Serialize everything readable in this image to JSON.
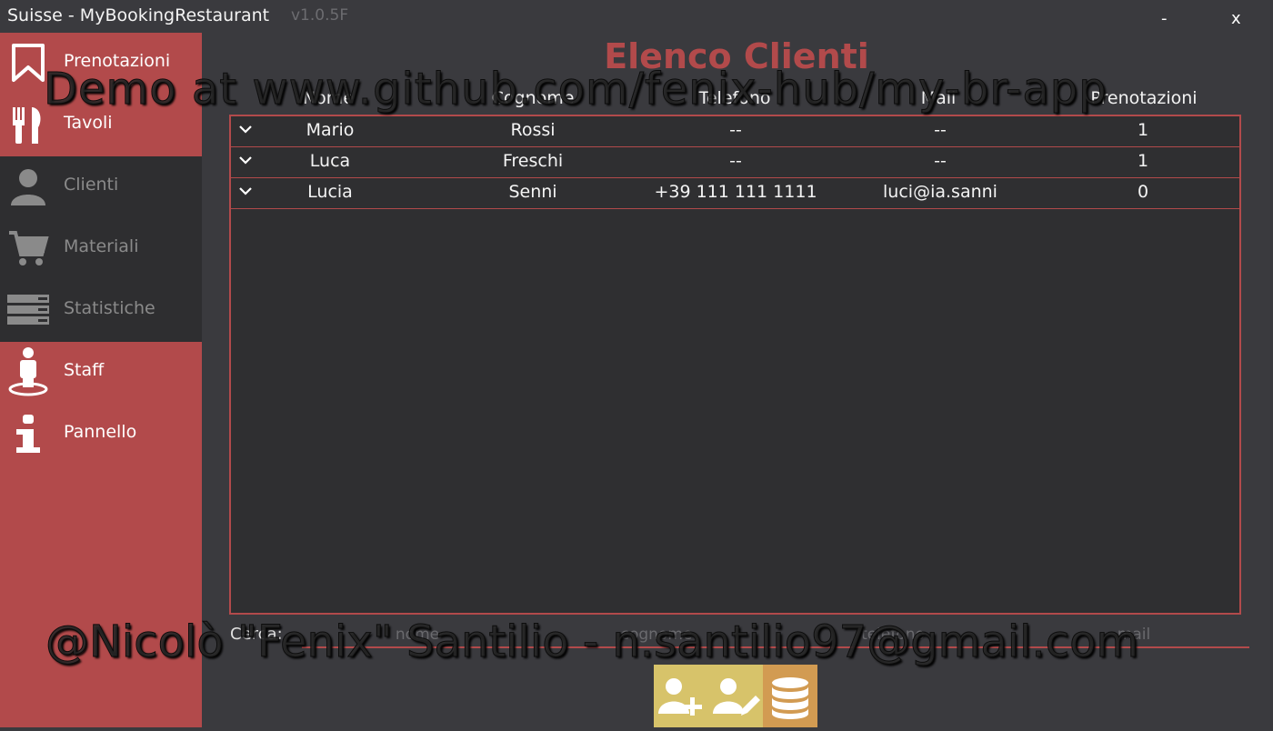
{
  "window": {
    "title": "Suisse - MyBookingRestaurant",
    "version": "v1.0.5F",
    "minimize": "-",
    "close": "x"
  },
  "sidebar": {
    "items": [
      {
        "label": "Prenotazioni",
        "icon": "bookmark-icon",
        "active": true
      },
      {
        "label": "Tavoli",
        "icon": "fork-knife-icon",
        "active": true
      },
      {
        "label": "Clienti",
        "icon": "user-icon",
        "active": false
      },
      {
        "label": "Materiali",
        "icon": "cart-icon",
        "active": false
      },
      {
        "label": "Statistiche",
        "icon": "server-icon",
        "active": false
      },
      {
        "label": "Staff",
        "icon": "person-icon",
        "active": true
      },
      {
        "label": "Pannello",
        "icon": "info-icon",
        "active": true
      }
    ]
  },
  "main": {
    "title": "Elenco Clienti",
    "columns": [
      "Nome",
      "Cognome",
      "Telefono",
      "Mail",
      "Prenotazioni"
    ],
    "rows": [
      [
        "Mario",
        "Rossi",
        "--",
        "--",
        "1"
      ],
      [
        "Luca",
        "Freschi",
        "--",
        "--",
        "1"
      ],
      [
        "Lucia",
        "Senni",
        "+39 111 111 1111",
        "luci@ia.sanni",
        "0"
      ]
    ]
  },
  "search": {
    "label": "Cerca:",
    "placeholders": [
      "nome",
      "cognome",
      "telefono",
      "mail"
    ]
  },
  "actions": [
    {
      "icon": "add-user-icon",
      "color": "#d7c36a"
    },
    {
      "icon": "edit-user-icon",
      "color": "#d7c36a"
    },
    {
      "icon": "database-icon",
      "color": "#d29b52"
    }
  ],
  "watermark": {
    "line1": "Demo at www.github.com/fenix-hub/my-br-app",
    "line2": "@Nicolò \"Fenix\" Santilio - n.santilio97@gmail.com"
  },
  "colors": {
    "accent": "#b24a4b",
    "background": "#3a3a3e",
    "table_bg": "#2f2f31"
  }
}
